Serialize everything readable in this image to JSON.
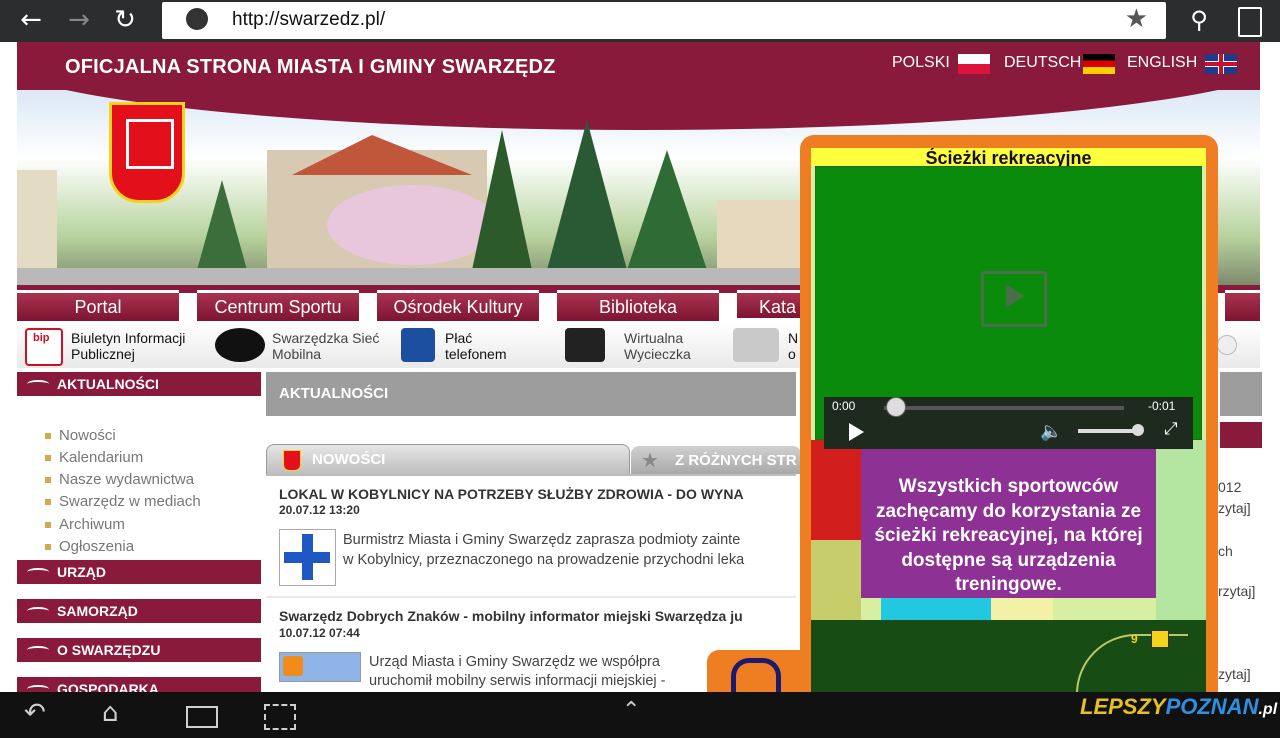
{
  "browser": {
    "url": "http://swarzedz.pl/",
    "back_icon": "arrow-left-icon",
    "forward_icon": "arrow-right-icon",
    "reload_icon": "reload-icon",
    "bookmark_icon": "star-icon",
    "search_icon": "search-icon",
    "history_icon": "bookmark-clock-icon"
  },
  "header": {
    "title": "OFICJALNA STRONA MIASTA I GMINY SWARZĘDZ",
    "languages": [
      "POLSKI",
      "DEUTSCH",
      "ENGLISH"
    ]
  },
  "menu": {
    "tabs": [
      "Portal",
      "Centrum Sportu",
      "Ośrodek Kultury",
      "Biblioteka",
      "Kata"
    ]
  },
  "quicklinks": [
    {
      "icon": "bip-icon",
      "label": "Biuletyn Informacji Publicznej"
    },
    {
      "icon": "wifi-icon",
      "label": "Swarzędzka Sieć Mobilna"
    },
    {
      "icon": "callpay-icon",
      "label": "Płać telefonem"
    },
    {
      "icon": "monitor-icon",
      "label": "Wirtualna Wycieczka"
    },
    {
      "icon": "newspaper-icon",
      "label": "N\no"
    }
  ],
  "sidebar": {
    "sections": [
      "AKTUALNOŚCI",
      "URZĄD",
      "SAMORZĄD",
      "O SWARZĘDZU",
      "GOSPODARKA"
    ],
    "subitems": [
      "Nowości",
      "Kalendarium",
      "Nasze wydawnictwa",
      "Swarzędz w mediach",
      "Archiwum",
      "Ogłoszenia"
    ]
  },
  "main": {
    "heading": "AKTUALNOŚCI",
    "tabs": [
      "NOWOŚCI",
      "Z RÓŻNYCH STR"
    ],
    "news": [
      {
        "title": "LOKAL W KOBYLNICY NA POTRZEBY SŁUŻBY ZDROWIA - DO WYNA",
        "date": "20.07.12 13:20",
        "line1": "Burmistrz Miasta i Gminy Swarzędz zaprasza podmioty zainte",
        "line2": "w Kobylnicy, przeznaczonego na prowadzenie przychodni leka"
      },
      {
        "title": "Swarzędz Dobrych Znaków - mobilny informator miejski Swarzędza ju",
        "date": "10.07.12 07:44",
        "line1": "Urząd Miasta i Gminy Swarzędz we współpra",
        "line2": "uruchomił mobilny serwis informacji miejskiej -"
      }
    ]
  },
  "rightcol": {
    "texts": [
      "012",
      "zytaj]",
      "ch",
      "rzytaj]",
      "zytaj]"
    ]
  },
  "popup": {
    "title": "Ścieżki rekreacyjne",
    "video_time_start": "0:00",
    "video_time_end": "-0:01",
    "message": "Wszystkich sportowców zachęcamy do korzystania ze ścieżki rekreacyjnej, na której dostępne są urządzenia treningowe.",
    "map_marker": "9"
  },
  "watermark": {
    "part1": "LEPSZY",
    "part2": "POZNAN",
    "suffix": ".pl"
  }
}
